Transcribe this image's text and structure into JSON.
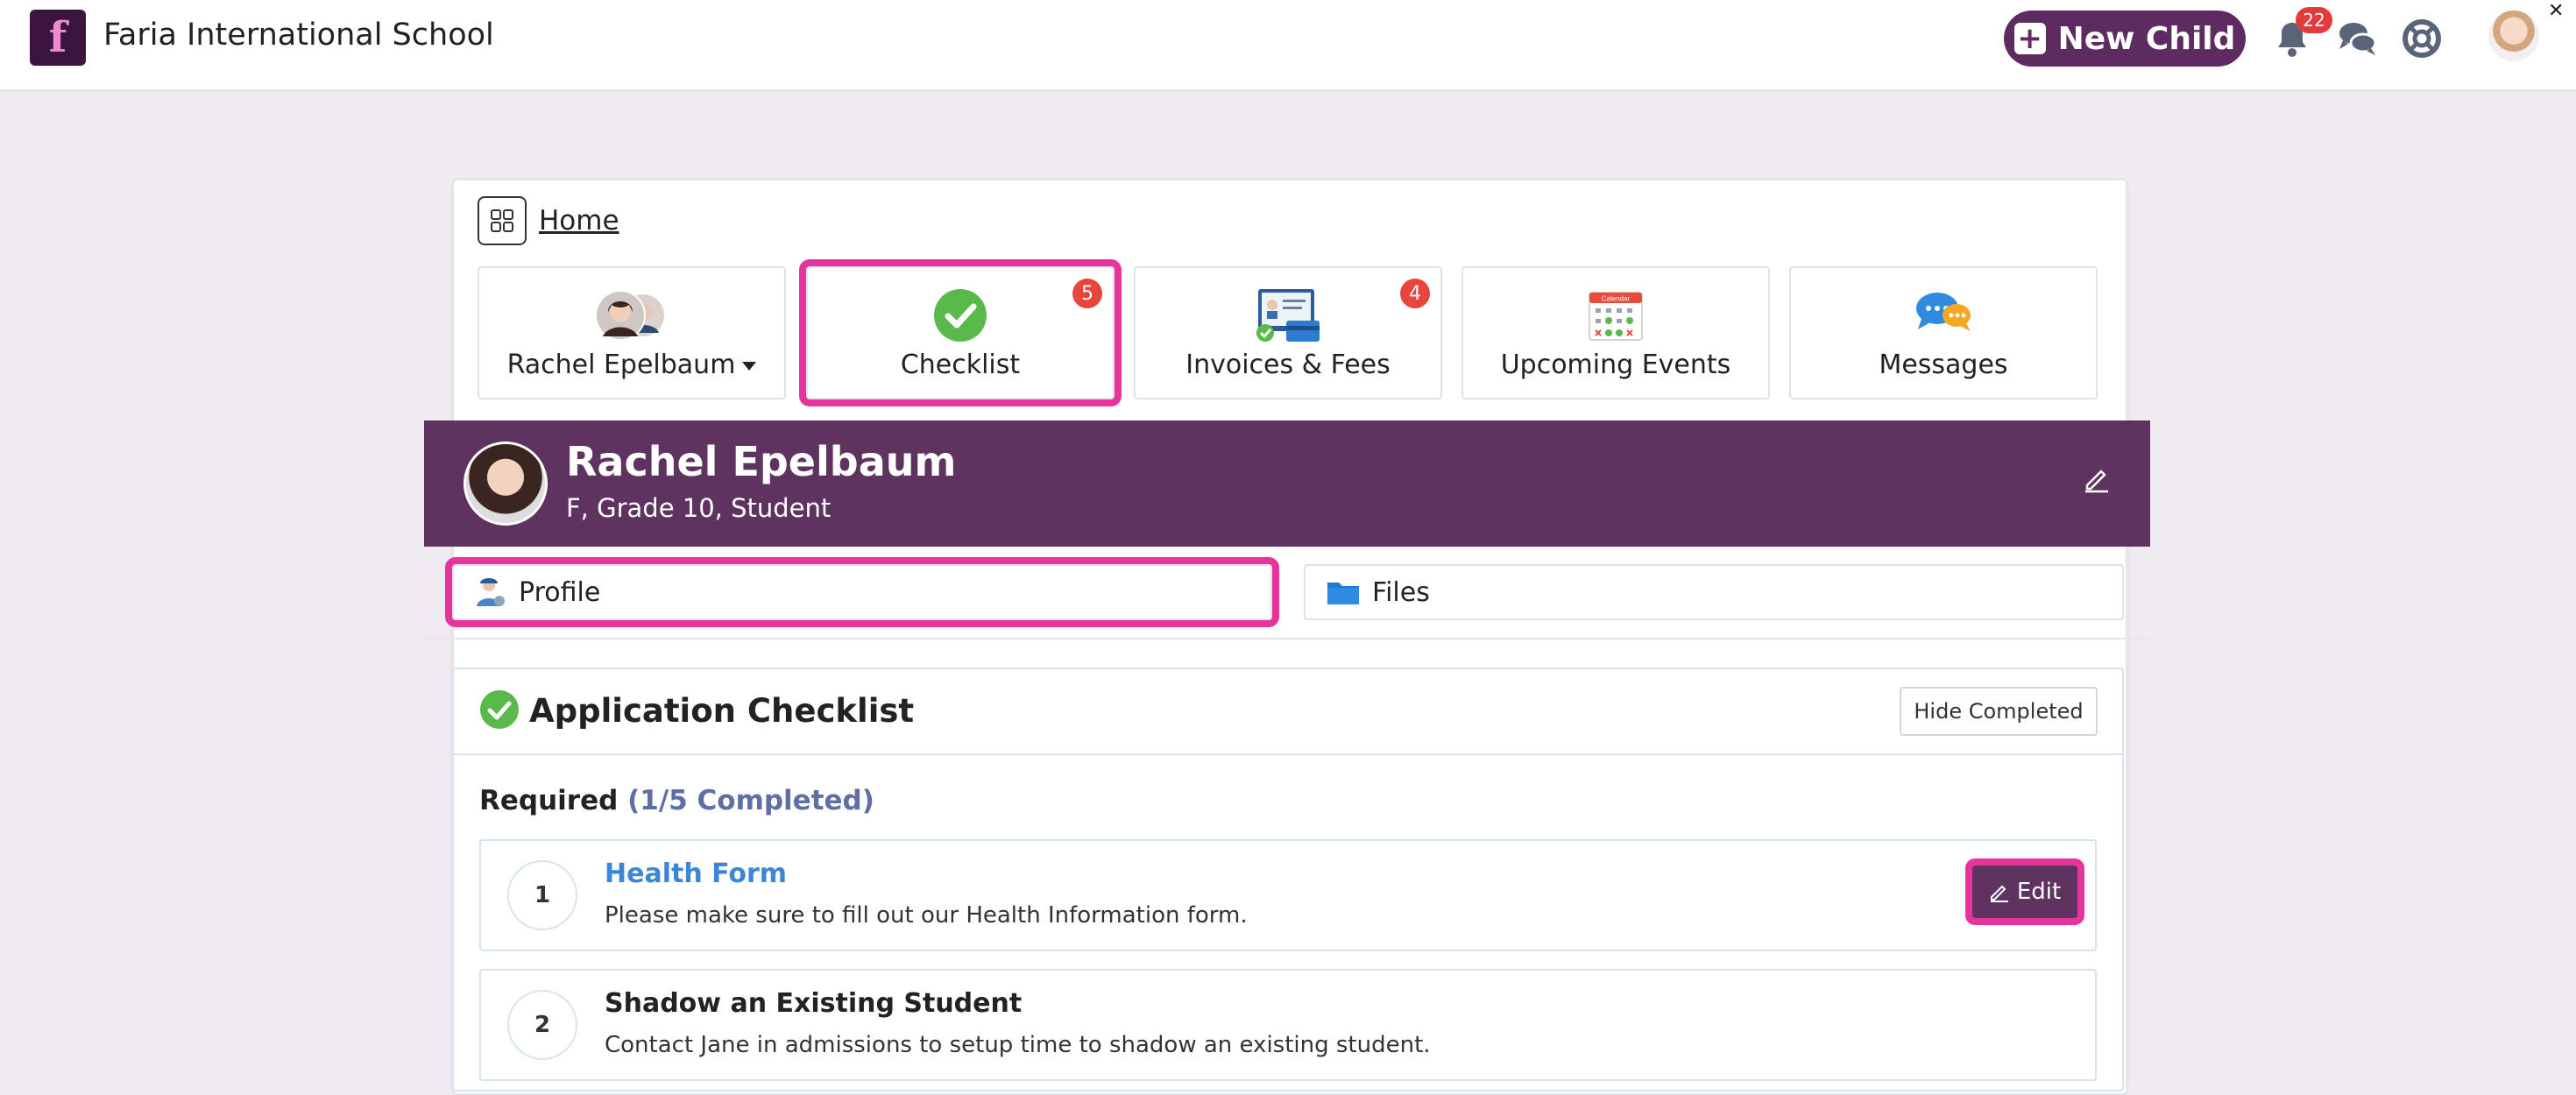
{
  "app": {
    "school_name": "Faria International School",
    "logo_letter": "f",
    "new_child_label": "New Child",
    "notification_count": "22",
    "close_glyph": "✕"
  },
  "breadcrumb": {
    "home_label": "Home"
  },
  "tiles": [
    {
      "label": "Rachel Epelbaum",
      "icon": "children-avatars-icon",
      "has_dropdown": true
    },
    {
      "label": "Checklist",
      "icon": "check-circle-icon",
      "badge": "5",
      "highlighted": true
    },
    {
      "label": "Invoices & Fees",
      "icon": "invoice-card-icon",
      "badge": "4"
    },
    {
      "label": "Upcoming Events",
      "icon": "calendar-icon"
    },
    {
      "label": "Messages",
      "icon": "chat-bubbles-icon"
    }
  ],
  "calendar_tile_text": "Calendar",
  "profile": {
    "name": "Rachel Epelbaum",
    "subtitle": "F, Grade 10, Student"
  },
  "sub_tabs": {
    "profile_label": "Profile",
    "files_label": "Files"
  },
  "checklist": {
    "title": "Application Checklist",
    "hide_completed_label": "Hide Completed",
    "required_label": "Required",
    "required_count": "(1/5 Completed)",
    "items": [
      {
        "number": "1",
        "title": "Health Form",
        "description": "Please make sure to fill out our Health Information form.",
        "action_label": "Edit"
      },
      {
        "number": "2",
        "title": "Shadow an Existing Student",
        "description": "Contact Jane in admissions to setup time to shadow an existing student."
      }
    ]
  },
  "colors": {
    "brand_purple": "#5e3360",
    "highlight_pink": "#e6339e",
    "badge_red": "#e8453c",
    "link_blue": "#3c86d8",
    "count_blue": "#5e6fa3",
    "page_bg": "#f0ebf0"
  }
}
